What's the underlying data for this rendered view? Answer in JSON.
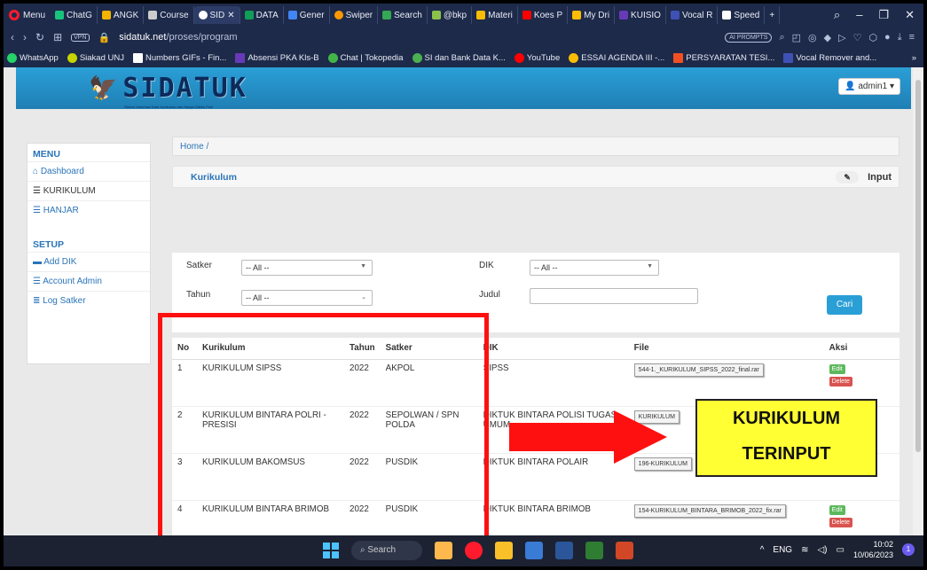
{
  "browser": {
    "menu_label": "Menu",
    "tabs": [
      "ChatG",
      "ANGK",
      "Course",
      "SID",
      "DATA",
      "Gener",
      "Swiper",
      "Search",
      "@bkp",
      "Materi",
      "Koes P",
      "My Dri",
      "KUISIO",
      "Vocal R",
      "Speed"
    ],
    "active_tab_index": 3,
    "new_tab": "+",
    "url_host": "sidatuk.net",
    "url_path": "/proses/program",
    "vpn": "VPN",
    "ai_prompts": "AI PROMPTS",
    "bookmarks": [
      "WhatsApp",
      "Siakad UNJ",
      "Numbers GIFs - Fin...",
      "Absensi PKA Kls-B",
      "Chat | Tokopedia",
      "SI dan Bank Data K...",
      "YouTube",
      "ESSAI AGENDA III -...",
      "PERSYARATAN TESI...",
      "Vocal Remover and..."
    ],
    "bookmark_more": "»"
  },
  "app": {
    "logo_text": "SIDATUK",
    "logo_subtitle": "Sistem Informasi Data Kurikulum dan Hanjar Diktuk Polri",
    "user_button": "admin1",
    "menu_header": "MENU",
    "menu_items": [
      "Dashboard",
      "KURIKULUM",
      "HANJAR"
    ],
    "setup_header": "SETUP",
    "setup_items": [
      "Add DIK",
      "Account Admin",
      "Log Satker"
    ],
    "breadcrumb": "Home /",
    "panel_title": "Kurikulum",
    "input_label": "Input",
    "filters": {
      "satker_label": "Satker",
      "satker_value": "-- All --",
      "dik_label": "DIK",
      "dik_value": "-- All --",
      "tahun_label": "Tahun",
      "tahun_value": "-- All --",
      "judul_label": "Judul",
      "judul_value": "",
      "search_button": "Cari"
    },
    "table": {
      "headers": [
        "No",
        "Kurikulum",
        "Tahun",
        "Satker",
        "DIK",
        "File",
        "Aksi"
      ],
      "rows": [
        {
          "no": "1",
          "kurikulum": "KURIKULUM SIPSS",
          "tahun": "2022",
          "satker": "AKPOL",
          "dik": "SIPSS",
          "file": "544-1._KURIKULUM_SIPSS_2022_final.rar"
        },
        {
          "no": "2",
          "kurikulum": "KURIKULUM BINTARA POLRI - PRESISI",
          "tahun": "2022",
          "satker": "SEPOLWAN / SPN POLDA",
          "dik": "DIKTUK BINTARA POLISI TUGAS UMUM",
          "file": "KURIKULUM"
        },
        {
          "no": "3",
          "kurikulum": "KURIKULUM BAKOMSUS",
          "tahun": "2022",
          "satker": "PUSDIK",
          "dik": "DIKTUK BINTARA POLAIR",
          "file": "196-KURIKULUM"
        },
        {
          "no": "4",
          "kurikulum": "KURIKULUM BINTARA BRIMOB",
          "tahun": "2022",
          "satker": "PUSDIK",
          "dik": "DIKTUK BINTARA BRIMOB",
          "file": "154-KURIKULUM_BINTARA_BRIMOB_2022_fix.rar"
        }
      ],
      "edit_label": "Edit",
      "delete_label": "Delete"
    }
  },
  "annotation": {
    "line1": "KURIKULUM",
    "line2": "TERINPUT",
    "box_color": "#ff1010",
    "callout_color": "#ffff33"
  },
  "taskbar": {
    "search_placeholder": "Search",
    "lang": "ENG",
    "time": "10:02",
    "date": "10/06/2023",
    "notif_count": "1"
  }
}
